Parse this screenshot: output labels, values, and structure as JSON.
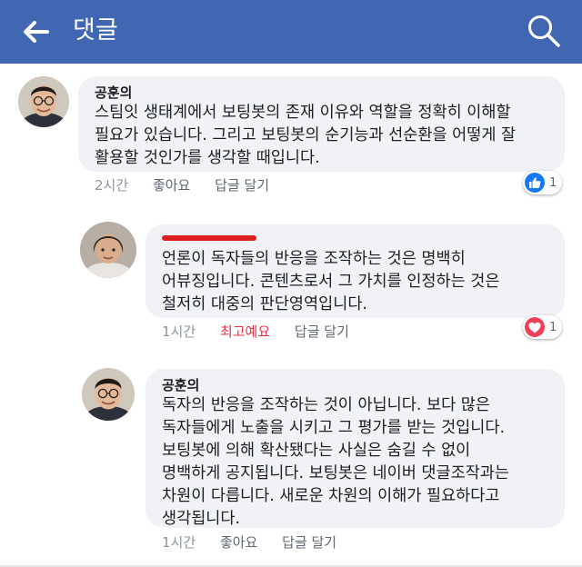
{
  "header": {
    "title": "댓글",
    "bg_color": "#4267b2"
  },
  "comments": [
    {
      "author": "공훈의",
      "text": "스팀잇 생태계에서 보팅봇의 존재 이유와 역할을 정확히 이해할\n필요가 있습니다. 그리고 보팅봇의 순기능과 선순환을 어떻게 잘\n활용할 것인가를 생각할 때입니다.",
      "time": "2시간",
      "like_label": "좋아요",
      "reply_label": "답글 달기",
      "reaction": {
        "icon": "thumbs-up",
        "count": "1",
        "color": "#1877f2"
      }
    },
    {
      "author": "",
      "text": "언론이 독자들의 반응을 조작하는 것은 명백히\n어뷰징입니다. 콘텐츠로서 그 가치를 인정하는 것은\n철저히 대중의 판단영역입니다.",
      "time": "1시간",
      "like_label": "최고예요",
      "reply_label": "답글 달기",
      "reaction": {
        "icon": "heart",
        "count": "1",
        "color": "#f33e58"
      }
    },
    {
      "author": "공훈의",
      "text": "독자의 반응을 조작하는 것이 아닙니다. 보다 많은\n독자들에게 노출을 시키고 그 평가를 받는 것입니다.\n보팅봇에 의해 확산됐다는 사실은 숨길 수 없이\n명백하게 공지됩니다. 보팅봇은 네이버 댓글조작과는\n차원이 다릅니다. 새로운 차원의 이해가 필요하다고\n생각됩니다.",
      "time": "1시간",
      "like_label": "좋아요",
      "reply_label": "답글 달기"
    }
  ]
}
